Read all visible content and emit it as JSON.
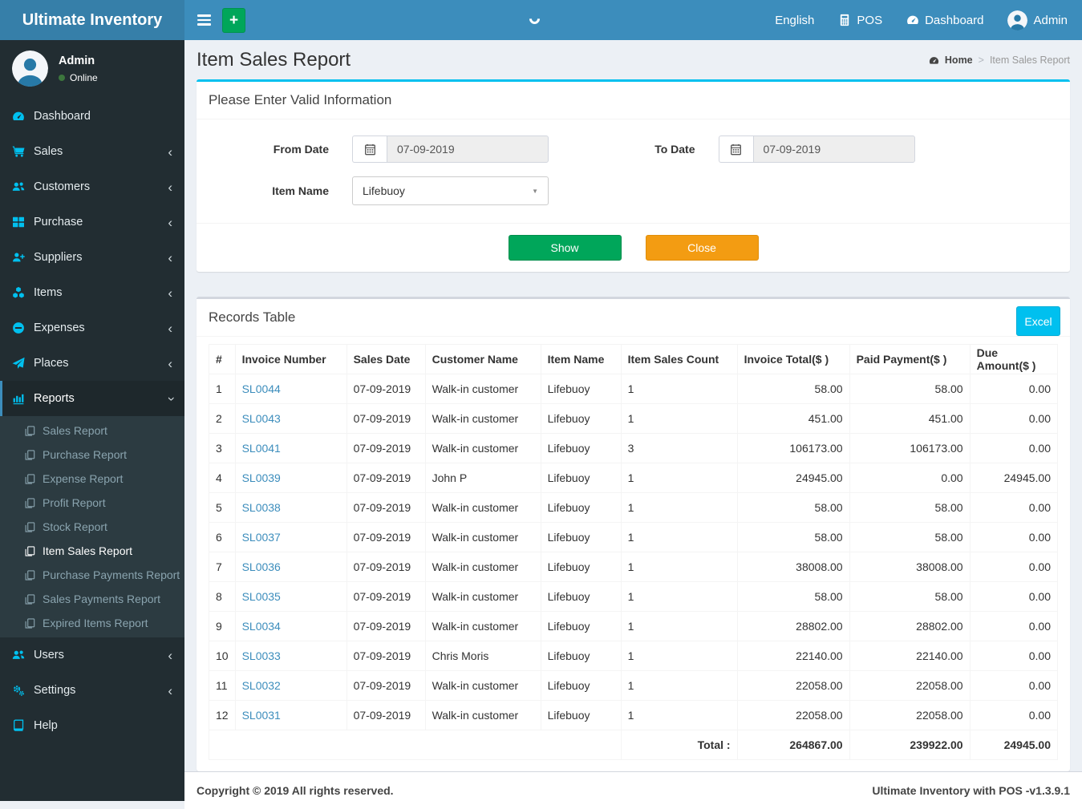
{
  "navbar": {
    "brand": "Ultimate Inventory",
    "add_button": "+",
    "language": "English",
    "pos": "POS",
    "dashboard": "Dashboard",
    "user": "Admin"
  },
  "sidebar": {
    "user": {
      "name": "Admin",
      "status": "Online"
    },
    "items": [
      {
        "label": "Dashboard"
      },
      {
        "label": "Sales"
      },
      {
        "label": "Customers"
      },
      {
        "label": "Purchase"
      },
      {
        "label": "Suppliers"
      },
      {
        "label": "Items"
      },
      {
        "label": "Expenses"
      },
      {
        "label": "Places"
      },
      {
        "label": "Reports"
      },
      {
        "label": "Users"
      },
      {
        "label": "Settings"
      },
      {
        "label": "Help"
      }
    ],
    "reports_children": [
      "Sales Report",
      "Purchase Report",
      "Expense Report",
      "Profit Report",
      "Stock Report",
      "Item Sales Report",
      "Purchase Payments Report",
      "Sales Payments Report",
      "Expired Items Report"
    ],
    "reports_active_item": "Item Sales Report"
  },
  "page": {
    "title": "Item Sales Report",
    "breadcrumb_home": "Home",
    "breadcrumb_current": "Item Sales Report"
  },
  "filter": {
    "title": "Please Enter Valid Information",
    "from_date_label": "From Date",
    "from_date_value": "07-09-2019",
    "to_date_label": "To Date",
    "to_date_value": "07-09-2019",
    "item_name_label": "Item Name",
    "item_name_value": "Lifebuoy",
    "show_button": "Show",
    "close_button": "Close"
  },
  "records": {
    "title": "Records Table",
    "excel_button": "Excel",
    "columns": [
      "#",
      "Invoice Number",
      "Sales Date",
      "Customer Name",
      "Item Name",
      "Item Sales Count",
      "Invoice Total($ )",
      "Paid Payment($ )",
      "Due Amount($ )"
    ],
    "rows": [
      {
        "num": "1",
        "invoice": "SL0044",
        "date": "07-09-2019",
        "customer": "Walk-in customer",
        "item": "Lifebuoy",
        "count": "1",
        "total": "58.00",
        "paid": "58.00",
        "due": "0.00"
      },
      {
        "num": "2",
        "invoice": "SL0043",
        "date": "07-09-2019",
        "customer": "Walk-in customer",
        "item": "Lifebuoy",
        "count": "1",
        "total": "451.00",
        "paid": "451.00",
        "due": "0.00"
      },
      {
        "num": "3",
        "invoice": "SL0041",
        "date": "07-09-2019",
        "customer": "Walk-in customer",
        "item": "Lifebuoy",
        "count": "3",
        "total": "106173.00",
        "paid": "106173.00",
        "due": "0.00"
      },
      {
        "num": "4",
        "invoice": "SL0039",
        "date": "07-09-2019",
        "customer": "John P",
        "item": "Lifebuoy",
        "count": "1",
        "total": "24945.00",
        "paid": "0.00",
        "due": "24945.00"
      },
      {
        "num": "5",
        "invoice": "SL0038",
        "date": "07-09-2019",
        "customer": "Walk-in customer",
        "item": "Lifebuoy",
        "count": "1",
        "total": "58.00",
        "paid": "58.00",
        "due": "0.00"
      },
      {
        "num": "6",
        "invoice": "SL0037",
        "date": "07-09-2019",
        "customer": "Walk-in customer",
        "item": "Lifebuoy",
        "count": "1",
        "total": "58.00",
        "paid": "58.00",
        "due": "0.00"
      },
      {
        "num": "7",
        "invoice": "SL0036",
        "date": "07-09-2019",
        "customer": "Walk-in customer",
        "item": "Lifebuoy",
        "count": "1",
        "total": "38008.00",
        "paid": "38008.00",
        "due": "0.00"
      },
      {
        "num": "8",
        "invoice": "SL0035",
        "date": "07-09-2019",
        "customer": "Walk-in customer",
        "item": "Lifebuoy",
        "count": "1",
        "total": "58.00",
        "paid": "58.00",
        "due": "0.00"
      },
      {
        "num": "9",
        "invoice": "SL0034",
        "date": "07-09-2019",
        "customer": "Walk-in customer",
        "item": "Lifebuoy",
        "count": "1",
        "total": "28802.00",
        "paid": "28802.00",
        "due": "0.00"
      },
      {
        "num": "10",
        "invoice": "SL0033",
        "date": "07-09-2019",
        "customer": "Chris Moris",
        "item": "Lifebuoy",
        "count": "1",
        "total": "22140.00",
        "paid": "22140.00",
        "due": "0.00"
      },
      {
        "num": "11",
        "invoice": "SL0032",
        "date": "07-09-2019",
        "customer": "Walk-in customer",
        "item": "Lifebuoy",
        "count": "1",
        "total": "22058.00",
        "paid": "22058.00",
        "due": "0.00"
      },
      {
        "num": "12",
        "invoice": "SL0031",
        "date": "07-09-2019",
        "customer": "Walk-in customer",
        "item": "Lifebuoy",
        "count": "1",
        "total": "22058.00",
        "paid": "22058.00",
        "due": "0.00"
      }
    ],
    "total_label": "Total :",
    "total_invoice": "264867.00",
    "total_paid": "239922.00",
    "total_due": "24945.00"
  },
  "footer": {
    "left": "Copyright © 2019 All rights reserved.",
    "right": "Ultimate Inventory with POS -v1.3.9.1"
  },
  "icons": {
    "chevron_collapsed": "‹",
    "select_caret": "▼",
    "breadcrumb_sep": ">"
  },
  "colors": {
    "navbar_blue": "#3c8dbc",
    "brand_blue": "#367fa9",
    "sidebar_dark": "#222d32",
    "accent_cyan": "#00c0ef",
    "success_green": "#00a65a",
    "warning_orange": "#f39c12",
    "link_blue": "#3c8dbc"
  }
}
